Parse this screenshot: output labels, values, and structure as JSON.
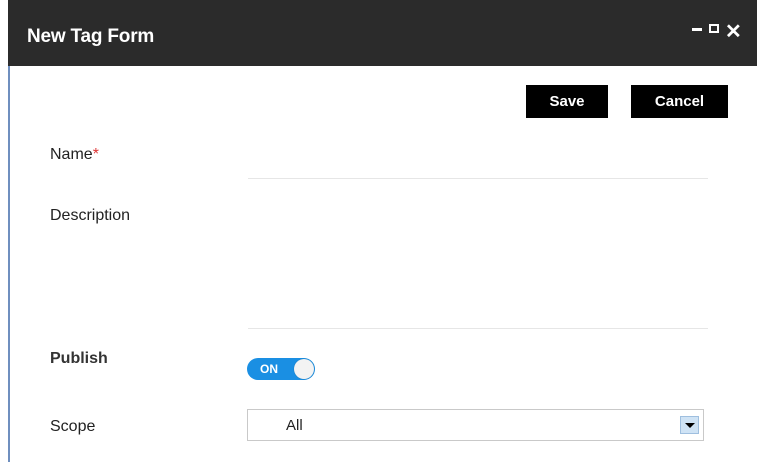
{
  "window": {
    "title": "New Tag Form"
  },
  "toolbar": {
    "save_label": "Save",
    "cancel_label": "Cancel"
  },
  "form": {
    "name": {
      "label": "Name",
      "required_marker": "*",
      "value": ""
    },
    "description": {
      "label": "Description",
      "value": ""
    },
    "publish": {
      "label": "Publish",
      "toggle_text": "ON",
      "state": "on"
    },
    "scope": {
      "label": "Scope",
      "selected": "All"
    }
  },
  "colors": {
    "titlebar": "#2b2b2b",
    "toggle_on": "#1a8fe3",
    "required": "#dd3333",
    "button_bg": "#000000"
  }
}
